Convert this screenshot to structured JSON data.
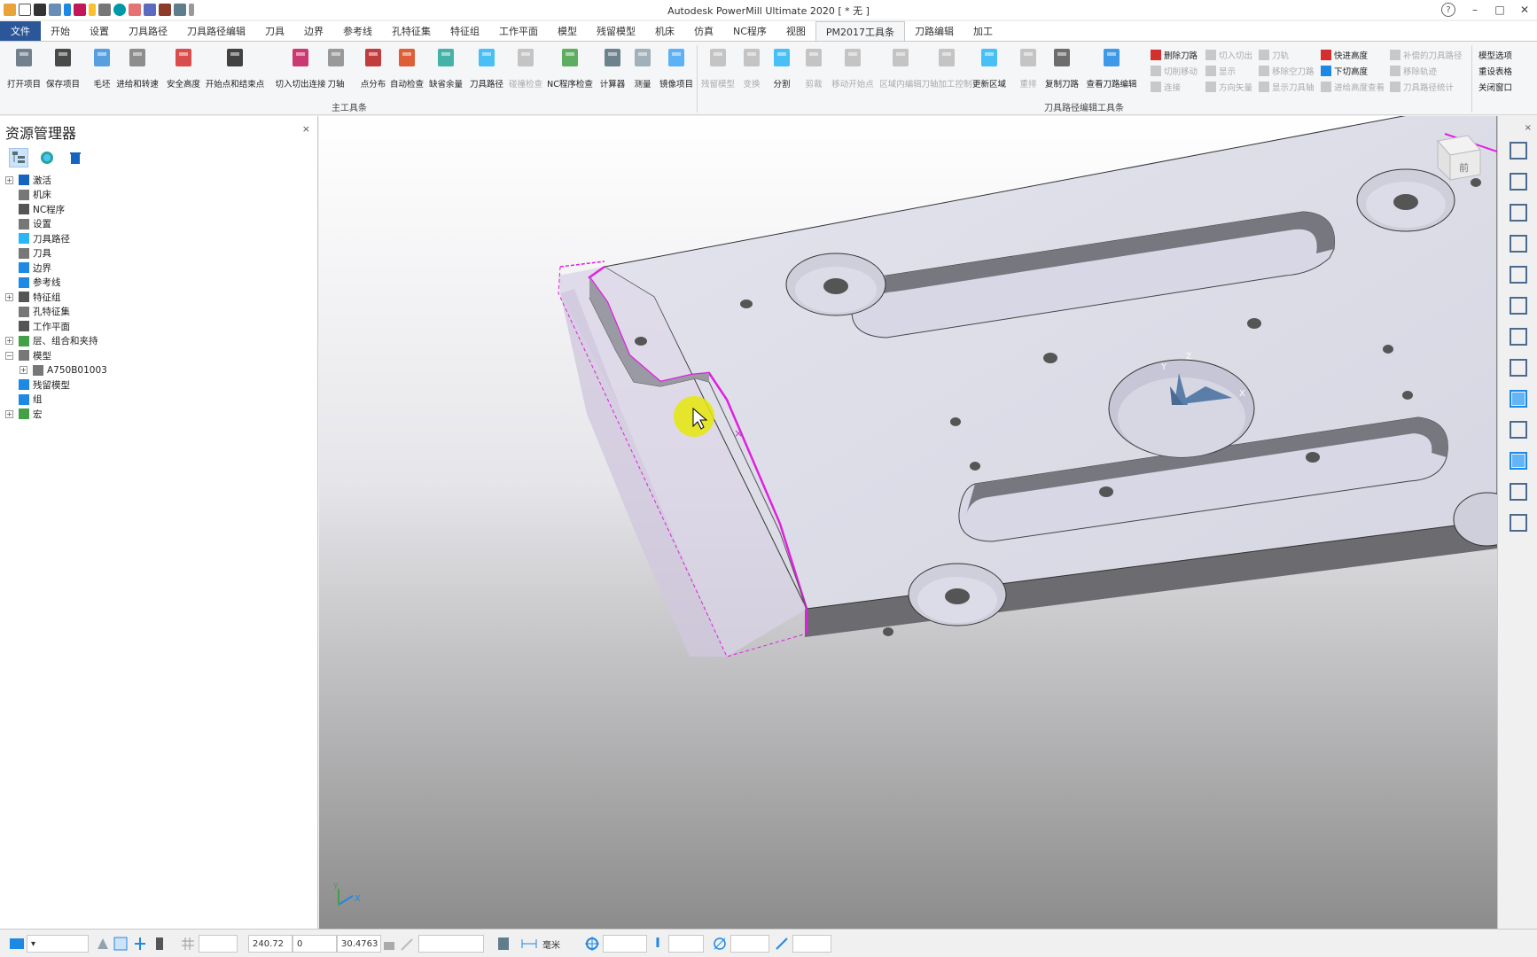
{
  "window": {
    "title": "Autodesk PowerMill Ultimate 2020    [ * 无 ]",
    "help": "?",
    "minimize": "–",
    "maximize": "□",
    "close": "✕"
  },
  "tabs": [
    {
      "label": "文件",
      "type": "file"
    },
    {
      "label": "开始"
    },
    {
      "label": "设置"
    },
    {
      "label": "刀具路径"
    },
    {
      "label": "刀具路径编辑"
    },
    {
      "label": "刀具"
    },
    {
      "label": "边界"
    },
    {
      "label": "参考线"
    },
    {
      "label": "孔特征集"
    },
    {
      "label": "特征组"
    },
    {
      "label": "工作平面"
    },
    {
      "label": "模型"
    },
    {
      "label": "残留模型"
    },
    {
      "label": "机床"
    },
    {
      "label": "仿真"
    },
    {
      "label": "NC程序"
    },
    {
      "label": "视图"
    },
    {
      "label": "PM2017工具条",
      "active": true
    },
    {
      "label": "刀路编辑"
    },
    {
      "label": "加工"
    }
  ],
  "ribbon": {
    "main_group_label": "主工具条",
    "edit_group_label": "刀具路径编辑工具条",
    "main_buttons": [
      {
        "label": "打开项目",
        "color": "#5a6a7a"
      },
      {
        "label": "保存项目",
        "color": "#2a2a2a"
      },
      {
        "label": "毛坯",
        "color": "#3b8fd9"
      },
      {
        "label": "进给和转速",
        "color": "#7a7a7a"
      },
      {
        "label": "安全高度",
        "color": "#d32f2f"
      },
      {
        "label": "开始点和结束点",
        "color": "#222222"
      },
      {
        "label": "切入切出连接",
        "color": "#c2185b"
      },
      {
        "label": "刀轴",
        "color": "#888888"
      },
      {
        "label": "点分布",
        "color": "#b71c1c"
      },
      {
        "label": "自动检查",
        "color": "#d84315"
      },
      {
        "label": "缺省余量",
        "color": "#26a69a"
      },
      {
        "label": "刀具路径",
        "color": "#29b6f6"
      },
      {
        "label": "碰撞检查",
        "color": "#bbbbbb",
        "disabled": true
      },
      {
        "label": "NC程序检查",
        "color": "#43a047"
      },
      {
        "label": "计算器",
        "color": "#546e7a"
      },
      {
        "label": "测量",
        "color": "#90a4ae"
      },
      {
        "label": "镜像项目",
        "color": "#42a5f5"
      }
    ],
    "edit_buttons": [
      {
        "label": "残留模型",
        "color": "#bbbbbb",
        "disabled": true
      },
      {
        "label": "变换",
        "color": "#bbbbbb",
        "disabled": true
      },
      {
        "label": "分割",
        "color": "#29b6f6"
      },
      {
        "label": "剪裁",
        "color": "#bbbbbb",
        "disabled": true
      },
      {
        "label": "移动开始点",
        "color": "#bbbbbb",
        "disabled": true
      },
      {
        "label": "区域内编辑",
        "color": "#bbbbbb",
        "disabled": true
      },
      {
        "label": "刀轴加工控制",
        "color": "#bbbbbb",
        "disabled": true
      },
      {
        "label": "更新区域",
        "color": "#29b6f6"
      },
      {
        "label": "重排",
        "color": "#bbbbbb",
        "disabled": true
      },
      {
        "label": "复制刀路",
        "color": "#555555"
      },
      {
        "label": "查看刀路编辑",
        "color": "#1e88e5"
      }
    ],
    "small_buttons": [
      {
        "label": "删除刀路",
        "color": "#d32f2f"
      },
      {
        "label": "切入切出",
        "disabled": true
      },
      {
        "label": "刀轨",
        "disabled": true
      },
      {
        "label": "快进高度",
        "color": "#d32f2f"
      },
      {
        "label": "补偿的刀具路径",
        "disabled": true
      },
      {
        "label": "切削移动",
        "disabled": true
      },
      {
        "label": "显示",
        "disabled": true
      },
      {
        "label": "移除空刀路",
        "disabled": true
      },
      {
        "label": "下切高度",
        "color": "#1e88e5"
      },
      {
        "label": "移除轨迹",
        "disabled": true
      },
      {
        "label": "连接",
        "disabled": true
      },
      {
        "label": "方向矢量",
        "disabled": true
      },
      {
        "label": "显示刀具轴",
        "disabled": true
      },
      {
        "label": "进给高度查看",
        "disabled": true
      },
      {
        "label": "刀具路径统计",
        "disabled": true
      }
    ],
    "far_right": [
      "模型选项",
      "重设表格",
      "关闭窗口"
    ]
  },
  "explorer": {
    "title": "资源管理器",
    "close": "×",
    "items": [
      {
        "label": "激活",
        "expander": "+",
        "color": "#1565c0"
      },
      {
        "label": "机床",
        "expander": "",
        "color": "#777777"
      },
      {
        "label": "NC程序",
        "expander": "",
        "color": "#555555"
      },
      {
        "label": "设置",
        "expander": "",
        "color": "#777777"
      },
      {
        "label": "刀具路径",
        "expander": "",
        "color": "#29b6f6"
      },
      {
        "label": "刀具",
        "expander": "",
        "color": "#777777"
      },
      {
        "label": "边界",
        "expander": "",
        "color": "#1e88e5"
      },
      {
        "label": "参考线",
        "expander": "",
        "color": "#1e88e5"
      },
      {
        "label": "特征组",
        "expander": "+",
        "color": "#555555"
      },
      {
        "label": "孔特征集",
        "expander": "",
        "color": "#777777"
      },
      {
        "label": "工作平面",
        "expander": "",
        "color": "#555555"
      },
      {
        "label": "层、组合和夹持",
        "expander": "+",
        "color": "#43a047"
      },
      {
        "label": "模型",
        "expander": "−",
        "color": "#777777"
      },
      {
        "label": "A750B01003",
        "expander": "+",
        "color": "#777777",
        "indent": true
      },
      {
        "label": "残留模型",
        "expander": "",
        "color": "#1e88e5"
      },
      {
        "label": "组",
        "expander": "",
        "color": "#1e88e5"
      },
      {
        "label": "宏",
        "expander": "+",
        "color": "#43a047"
      }
    ]
  },
  "viewport": {
    "viewcube_label": "前",
    "axis_x": "X",
    "axis_y": "Y",
    "axis_z": "Z",
    "triad_x": "X",
    "triad_y": "Y"
  },
  "status": {
    "x_value": "240.72",
    "y_value": "0",
    "z_value": "30.4763",
    "units": "毫米"
  }
}
